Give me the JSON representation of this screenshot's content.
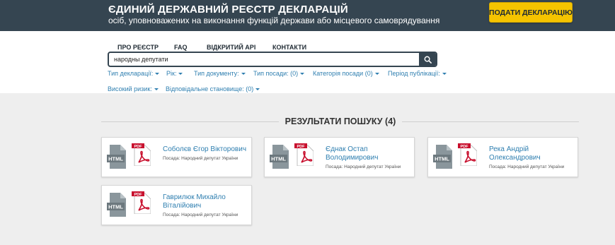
{
  "header": {
    "title": "ЄДИНИЙ ДЕРЖАВНИЙ РЕЄСТР ДЕКЛАРАЦІЙ",
    "subtitle": "осіб, уповноважених на виконання функцій держави або місцевого самоврядування",
    "submit_label": "ПОДАТИ ДЕКЛАРАЦІЮ"
  },
  "nav": {
    "items": [
      "ПРО РЕЄСТР",
      "FAQ",
      "ВІДКРИТИЙ API",
      "КОНТАКТИ"
    ]
  },
  "search": {
    "value": "народны депутати",
    "button_icon": "search-icon"
  },
  "filters": [
    "Тип декларації:",
    "Рік:",
    "Тип документу:",
    "Тип посади: (0)",
    "Категорія посади (0)",
    "Період публікації:",
    "Високий ризик:",
    "Відповідальне становище: (0)"
  ],
  "results": {
    "title": "РЕЗУЛЬТАТИ ПОШУКУ (4)",
    "html_label": "HTML",
    "pdf_label": "PDF",
    "items": [
      {
        "name": "Соболєв Єгор Вікторович",
        "position": "Посада: Народний депутат України"
      },
      {
        "name": "Єднак Остап Володимирович",
        "position": "Посада: Народний депутат України"
      },
      {
        "name": "Река Андрій Олександрович",
        "position": "Посада: Народний депутат України"
      },
      {
        "name": "Гаврилюк Михайло Віталійович",
        "position": "Посада: Народний депутат України"
      }
    ]
  },
  "colors": {
    "header_bg": "#354551",
    "accent_button": "#f5c400",
    "link": "#2f7fb0",
    "pdf_red": "#c8102e",
    "doc_gray": "#8a969c"
  }
}
